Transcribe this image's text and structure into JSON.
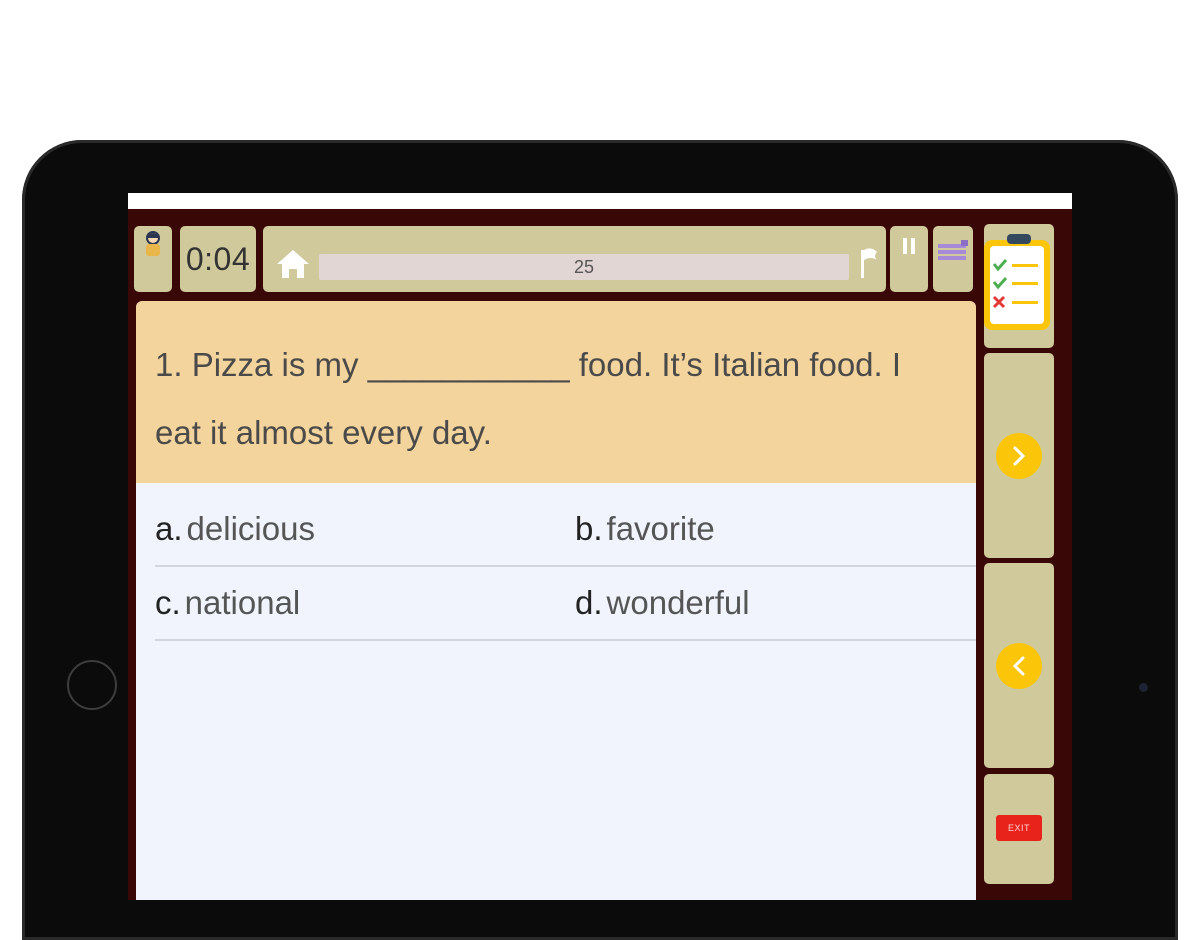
{
  "timer": "0:04",
  "progress": {
    "label": "25",
    "fraction": 0.0
  },
  "question": {
    "text": "1. Pizza is my ___________ food. It’s Italian food. I eat it almost every day."
  },
  "answers": [
    {
      "letter": "a.",
      "text": "delicious"
    },
    {
      "letter": "b.",
      "text": "favorite"
    },
    {
      "letter": "c.",
      "text": "national"
    },
    {
      "letter": "d.",
      "text": "wonderful"
    }
  ],
  "exit_label": "EXIT",
  "colors": {
    "frame": "#3a0707",
    "tile": "#cfc99b",
    "question_bg": "#f3d49c",
    "answers_bg": "#f1f4fc",
    "nav_button": "#fbc60a",
    "exit_button": "#e8231c"
  },
  "icons": [
    "avatar-icon",
    "home-icon",
    "flag-icon",
    "pause-icon",
    "menu-icon",
    "checklist-icon",
    "chevron-right-icon",
    "chevron-left-icon"
  ]
}
